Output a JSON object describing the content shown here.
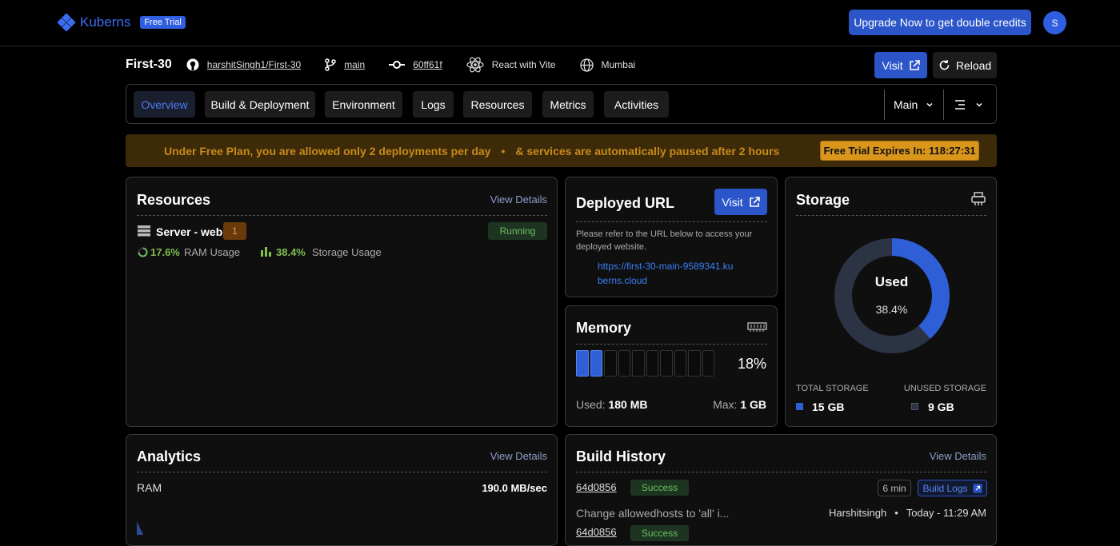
{
  "brand": {
    "name": "Kuberns",
    "badge": "Free Trial"
  },
  "header": {
    "upgrade_label": "Upgrade Now to get double credits",
    "avatar_initial": "S"
  },
  "project": {
    "name": "First-30",
    "repo": "harshitSingh1/First-30",
    "branch": "main",
    "commit": "60ff61f",
    "framework": "React with Vite",
    "region": "Mumbai",
    "visit_label": "Visit",
    "reload_label": "Reload"
  },
  "tabs": [
    {
      "label": "Overview",
      "active": true
    },
    {
      "label": "Build & Deployment"
    },
    {
      "label": "Environment"
    },
    {
      "label": "Logs"
    },
    {
      "label": "Resources"
    },
    {
      "label": "Metrics"
    },
    {
      "label": "Activities"
    }
  ],
  "env_select": "Main",
  "banner": {
    "part1": "Under Free Plan, you are allowed only 2 deployments per day",
    "part2": "& services are automatically paused after 2 hours",
    "expiry_label": "Free Trial Expires In: 118:27:31"
  },
  "resources": {
    "title": "Resources",
    "link": "View Details",
    "server_name": "Server - web",
    "count": "1",
    "status": "Running",
    "ram_value": "17.6%",
    "ram_label": "RAM Usage",
    "storage_value": "38.4%",
    "storage_label": "Storage Usage"
  },
  "deployed": {
    "title": "Deployed URL",
    "visit_label": "Visit",
    "description": "Please refer to the URL below to access your deployed website.",
    "url_line1": "https://first-30-main-9589341.ku",
    "url_line2": "berns.cloud"
  },
  "memory": {
    "title": "Memory",
    "percent_label": "18%",
    "percent": 18,
    "used_label": "Used:",
    "used_value": "180 MB",
    "max_label": "Max:",
    "max_value": "1 GB"
  },
  "storage": {
    "title": "Storage",
    "used_label": "Used",
    "used_percent_label": "38.4%",
    "used_fraction": 0.384,
    "total_label": "TOTAL STORAGE",
    "total_value": "15 GB",
    "unused_label": "UNUSED STORAGE",
    "unused_value": "9 GB"
  },
  "analytics": {
    "title": "Analytics",
    "link": "View Details",
    "metric": "RAM",
    "metric_value": "190.0 MB/sec"
  },
  "build_history": {
    "title": "Build History",
    "link": "View Details",
    "items": [
      {
        "commit": "64d0856",
        "status": "Success",
        "duration": "6 min",
        "logs_label": "Build Logs",
        "message": "Change allowedhosts to 'all' i...",
        "author": "Harshitsingh",
        "time": "Today - 11:29 AM"
      },
      {
        "commit": "64d0856",
        "status": "Success"
      }
    ]
  },
  "colors": {
    "accent": "#2b55c9",
    "success": "#4caf50",
    "warning": "#d9961a"
  }
}
